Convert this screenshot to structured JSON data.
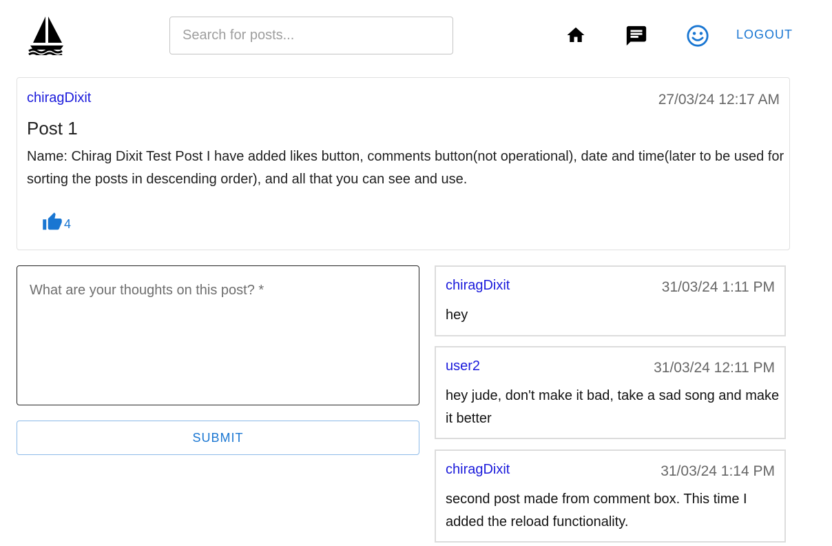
{
  "header": {
    "logo_icon": "sailboat-icon",
    "search_placeholder": "Search for posts...",
    "nav": [
      {
        "icon": "home-icon"
      },
      {
        "icon": "message-icon"
      },
      {
        "icon": "smiley-icon"
      }
    ],
    "logout_label": "LOGOUT"
  },
  "post": {
    "author": "chiragDixit",
    "date": "27/03/24 12:17 AM",
    "title": "Post 1",
    "body": "Name: Chirag Dixit Test Post I have added likes button, comments button(not operational), date and time(later to be used for sorting the posts in descending order), and all that you can see and use.",
    "likes": "4",
    "like_icon": "thumbs-up-icon"
  },
  "comment_form": {
    "placeholder": "What are your thoughts on this post? *",
    "submit_label": "SUBMIT"
  },
  "comments": [
    {
      "author": "chiragDixit",
      "date": "31/03/24 1:11 PM",
      "text": "hey"
    },
    {
      "author": "user2",
      "date": "31/03/24 12:11 PM",
      "text": "hey jude, don't make it bad, take a sad song and make it better"
    },
    {
      "author": "chiragDixit",
      "date": "31/03/24 1:14 PM",
      "text": "second post made from comment box. This time I added the reload functionality."
    }
  ],
  "colors": {
    "accent": "#1976d2",
    "author_link": "#1a1adb",
    "muted_text": "#666666"
  }
}
